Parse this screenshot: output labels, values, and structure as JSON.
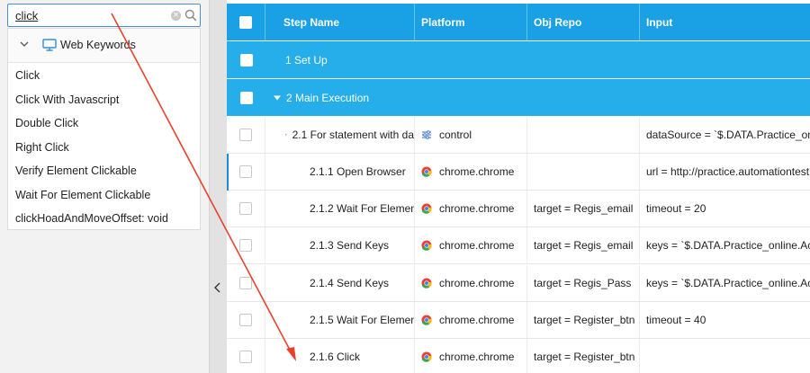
{
  "search": {
    "value": "click"
  },
  "keywords_panel": {
    "group_label": "Web Keywords",
    "items": [
      "Click",
      "Click With Javascript",
      "Double Click",
      "Right Click",
      "Verify Element Clickable",
      "Wait For Element Clickable",
      "clickHoadAndMoveOffset: void"
    ]
  },
  "table": {
    "headers": {
      "step_name": "Step Name",
      "platform": "Platform",
      "obj_repo": "Obj Repo",
      "input": "Input"
    },
    "sections": [
      {
        "label": "1 Set Up"
      },
      {
        "label": "2 Main Execution"
      }
    ],
    "rows": [
      {
        "step": "2.1 For statement with da",
        "platform": "control",
        "platform_icon": "control-icon",
        "obj": "",
        "input": "dataSource = `$.DATA.Practice_onli"
      },
      {
        "step": "2.1.1 Open Browser",
        "platform": "chrome.chrome",
        "platform_icon": "chrome-icon",
        "obj": "",
        "input": "url = http://practice.automationtestin"
      },
      {
        "step": "2.1.2 Wait For Elemen",
        "platform": "chrome.chrome",
        "platform_icon": "chrome-icon",
        "obj": "target = Regis_email",
        "input": "timeout = 20"
      },
      {
        "step": "2.1.3 Send Keys",
        "platform": "chrome.chrome",
        "platform_icon": "chrome-icon",
        "obj": "target = Regis_email",
        "input": "keys = `$.DATA.Practice_online.Acc"
      },
      {
        "step": "2.1.4 Send Keys",
        "platform": "chrome.chrome",
        "platform_icon": "chrome-icon",
        "obj": "target = Regis_Pass",
        "input": "keys = `$.DATA.Practice_online.Acc"
      },
      {
        "step": "2.1.5 Wait For Elemen",
        "platform": "chrome.chrome",
        "platform_icon": "chrome-icon",
        "obj": "target = Register_btn",
        "input": "timeout = 40"
      },
      {
        "step": "2.1.6 Click",
        "platform": "chrome.chrome",
        "platform_icon": "chrome-icon",
        "obj": "target = Register_btn",
        "input": ""
      }
    ]
  },
  "colors": {
    "header_bg": "#1aa0e5",
    "section_bg": "#26aeea",
    "annotation_arrow": "#e8412c"
  }
}
